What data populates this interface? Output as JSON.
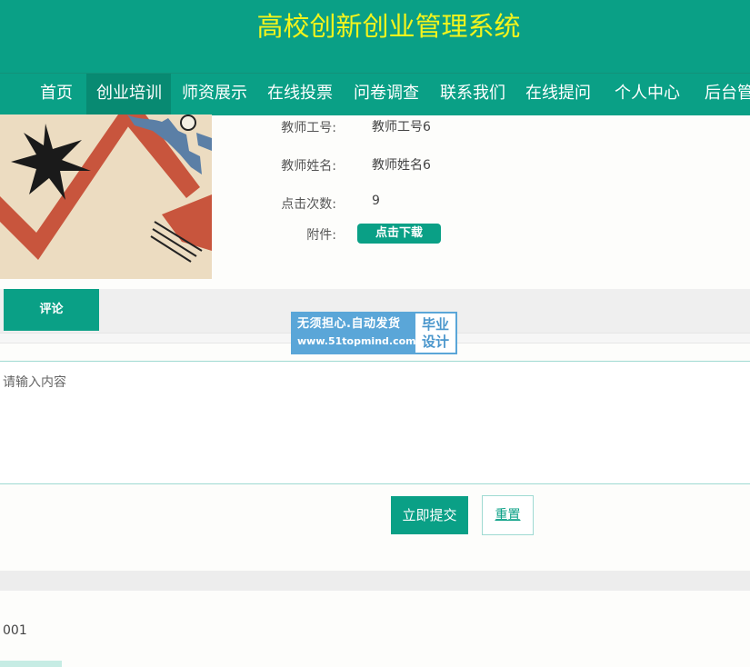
{
  "header": {
    "title": "高校创新创业管理系统"
  },
  "nav": {
    "items": [
      {
        "label": "首页"
      },
      {
        "label": "创业培训"
      },
      {
        "label": "师资展示"
      },
      {
        "label": "在线投票"
      },
      {
        "label": "问卷调查"
      },
      {
        "label": "联系我们"
      },
      {
        "label": "在线提问"
      },
      {
        "label": "个人中心"
      },
      {
        "label": "后台管理"
      }
    ],
    "active_item": "创业培训"
  },
  "detail": {
    "teacher_id_label": "教师工号:",
    "teacher_id_value": "教师工号6",
    "teacher_name_label": "教师姓名:",
    "teacher_name_value": "教师姓名6",
    "clicks_label": "点击次数:",
    "clicks_value": "9",
    "attachment_label": "附件:",
    "download_label": "点击下载"
  },
  "tabs": {
    "comment_label": "评论"
  },
  "comment": {
    "placeholder": "请输入内容",
    "submit_label": "立即提交",
    "reset_label": "重置",
    "first_user": "001"
  },
  "watermark": {
    "line1": "无须担心.自动发货",
    "line2": "www.51topmind.com",
    "right_line1": "毕业",
    "right_line2": "设计"
  },
  "colors": {
    "primary": "#0aa086",
    "title_yellow": "#f4f41c",
    "watermark_blue": "#5aa6d8"
  }
}
